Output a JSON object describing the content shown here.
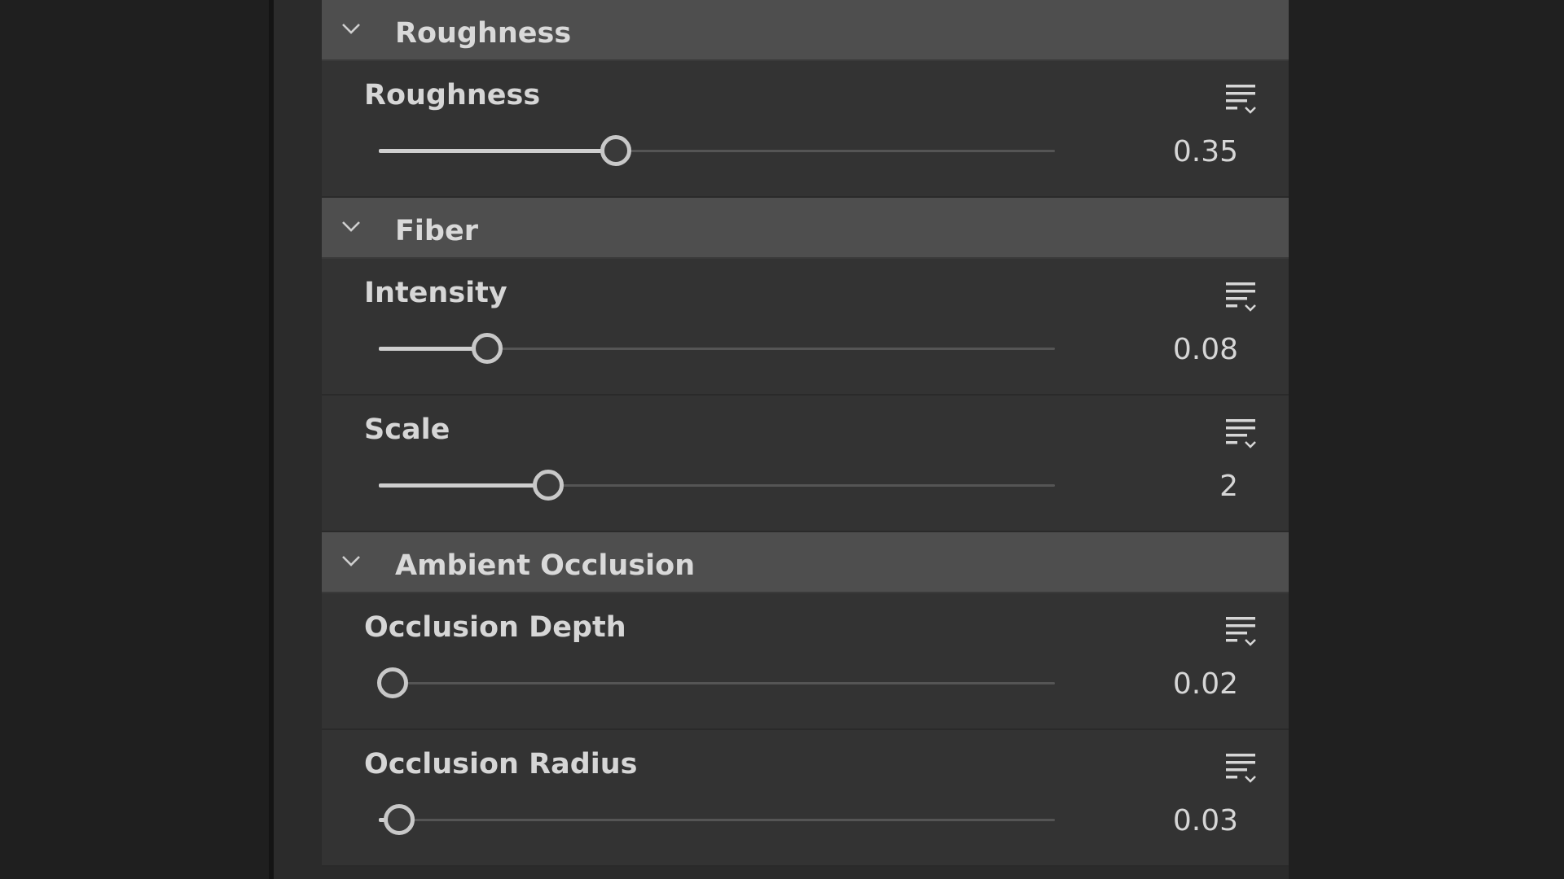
{
  "sections": [
    {
      "title": "Roughness",
      "params": [
        {
          "label": "Roughness",
          "value": "0.35",
          "fraction": 0.35
        }
      ]
    },
    {
      "title": "Fiber",
      "params": [
        {
          "label": "Intensity",
          "value": "0.08",
          "fraction": 0.16
        },
        {
          "label": "Scale",
          "value": "2",
          "fraction": 0.25
        }
      ]
    },
    {
      "title": "Ambient Occlusion",
      "params": [
        {
          "label": "Occlusion Depth",
          "value": "0.02",
          "fraction": 0.02
        },
        {
          "label": "Occlusion Radius",
          "value": "0.03",
          "fraction": 0.03
        }
      ]
    }
  ],
  "icons": {
    "collapse": "chevron-down-icon",
    "options": "list-options-icon"
  },
  "colors": {
    "panel": "#333333",
    "header": "#4e4e4e",
    "text": "#d6d6d6",
    "slider_fill": "#cfcfcf",
    "slider_track": "#555555"
  }
}
